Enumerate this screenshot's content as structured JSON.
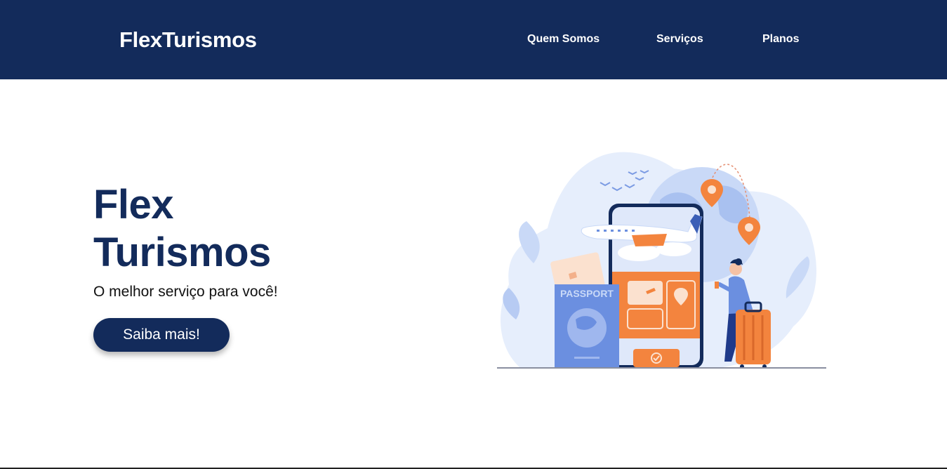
{
  "header": {
    "brand": "FlexTurismos",
    "nav": [
      {
        "label": "Quem Somos"
      },
      {
        "label": "Serviços"
      },
      {
        "label": "Planos"
      }
    ]
  },
  "hero": {
    "title_line1": "Flex",
    "title_line2": "Turismos",
    "subtitle": "O melhor serviço para você!",
    "cta_label": "Saiba mais!"
  },
  "illustration": {
    "passport_text": "PASSPORT",
    "icons": [
      "phone-icon",
      "airplane-icon",
      "passport-icon",
      "map-pin-icon",
      "suitcase-icon",
      "traveler-figure"
    ]
  },
  "colors": {
    "navbar": "#132b5b",
    "accent_orange": "#f3843e",
    "light_blue": "#e6eefc",
    "mid_blue": "#6b8fe0"
  }
}
